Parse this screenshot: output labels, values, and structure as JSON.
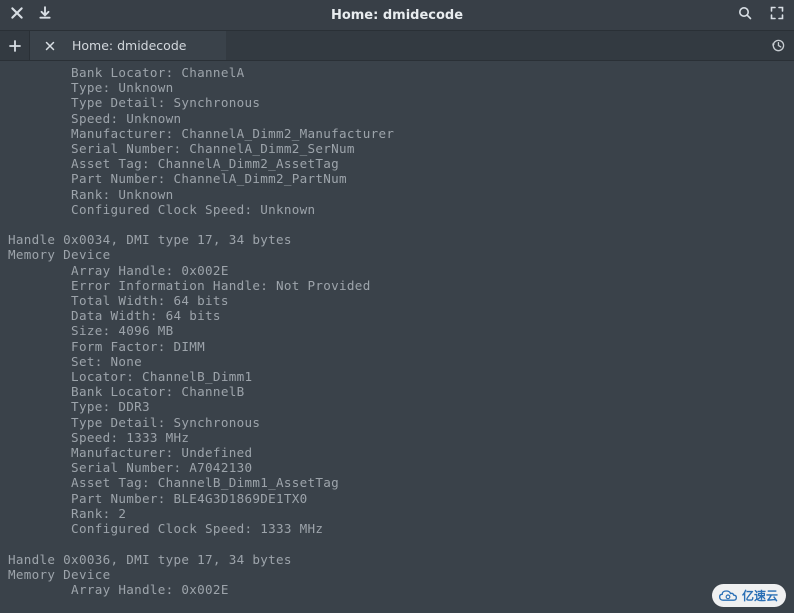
{
  "window": {
    "title": "Home: dmidecode"
  },
  "tab": {
    "label": "Home: dmidecode"
  },
  "terminal": {
    "block1": {
      "indent": "        ",
      "lines": [
        "Bank Locator: ChannelA",
        "Type: Unknown",
        "Type Detail: Synchronous",
        "Speed: Unknown",
        "Manufacturer: ChannelA_Dimm2_Manufacturer",
        "Serial Number: ChannelA_Dimm2_SerNum",
        "Asset Tag: ChannelA_Dimm2_AssetTag",
        "Part Number: ChannelA_Dimm2_PartNum",
        "Rank: Unknown",
        "Configured Clock Speed: Unknown"
      ]
    },
    "block2": {
      "header1": "Handle 0x0034, DMI type 17, 34 bytes",
      "header2": "Memory Device",
      "indent": "        ",
      "lines": [
        "Array Handle: 0x002E",
        "Error Information Handle: Not Provided",
        "Total Width: 64 bits",
        "Data Width: 64 bits",
        "Size: 4096 MB",
        "Form Factor: DIMM",
        "Set: None",
        "Locator: ChannelB_Dimm1",
        "Bank Locator: ChannelB",
        "Type: DDR3",
        "Type Detail: Synchronous",
        "Speed: 1333 MHz",
        "Manufacturer: Undefined",
        "Serial Number: A7042130",
        "Asset Tag: ChannelB_Dimm1_AssetTag",
        "Part Number: BLE4G3D1869DE1TX0",
        "Rank: 2",
        "Configured Clock Speed: 1333 MHz"
      ]
    },
    "block3": {
      "header1": "Handle 0x0036, DMI type 17, 34 bytes",
      "header2": "Memory Device",
      "indent": "        ",
      "lines": [
        "Array Handle: 0x002E"
      ]
    }
  },
  "watermark": {
    "text": "亿速云"
  }
}
